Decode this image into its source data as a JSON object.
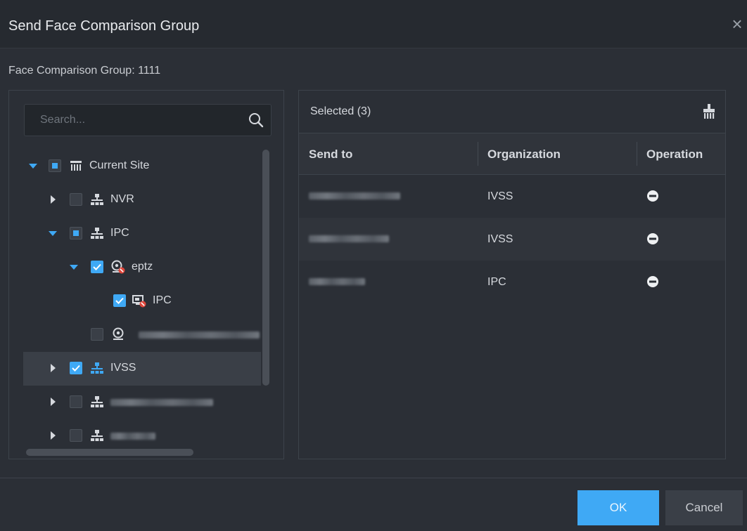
{
  "dialog": {
    "title": "Send Face Comparison Group",
    "close_symbol": "×",
    "group_label": "Face Comparison Group: 1111"
  },
  "search": {
    "placeholder": "Search...",
    "value": ""
  },
  "tree": {
    "items": [
      {
        "label": "Current Site",
        "expanded": true,
        "check": "partial",
        "icon": "site-icon"
      },
      {
        "label": "NVR",
        "expanded": false,
        "check": "unchecked",
        "icon": "org-icon"
      },
      {
        "label": "IPC",
        "expanded": true,
        "check": "partial",
        "icon": "org-icon"
      },
      {
        "label": "eptz",
        "expanded": true,
        "check": "checked",
        "icon": "camera-offline-icon"
      },
      {
        "label": "IPC",
        "check": "checked",
        "icon": "channel-offline-icon"
      },
      {
        "label": "",
        "check": "unchecked",
        "icon": "camera-icon"
      },
      {
        "label": "IVSS",
        "expanded": false,
        "check": "checked",
        "icon": "org-icon"
      },
      {
        "label": "",
        "expanded": false,
        "check": "unchecked",
        "icon": "org-icon"
      },
      {
        "label": "",
        "expanded": false,
        "check": "unchecked",
        "icon": "org-icon"
      }
    ]
  },
  "selected": {
    "title": "Selected (3)",
    "columns": [
      "Send to",
      "Organization",
      "Operation"
    ],
    "rows": [
      {
        "send_to": "",
        "organization": "IVSS"
      },
      {
        "send_to": "",
        "organization": "IVSS"
      },
      {
        "send_to": "",
        "organization": "IPC"
      }
    ]
  },
  "footer": {
    "ok_label": "OK",
    "cancel_label": "Cancel"
  },
  "colors": {
    "accent": "#3fa9f5",
    "background": "#2b2f36",
    "alert": "#e0473c"
  }
}
